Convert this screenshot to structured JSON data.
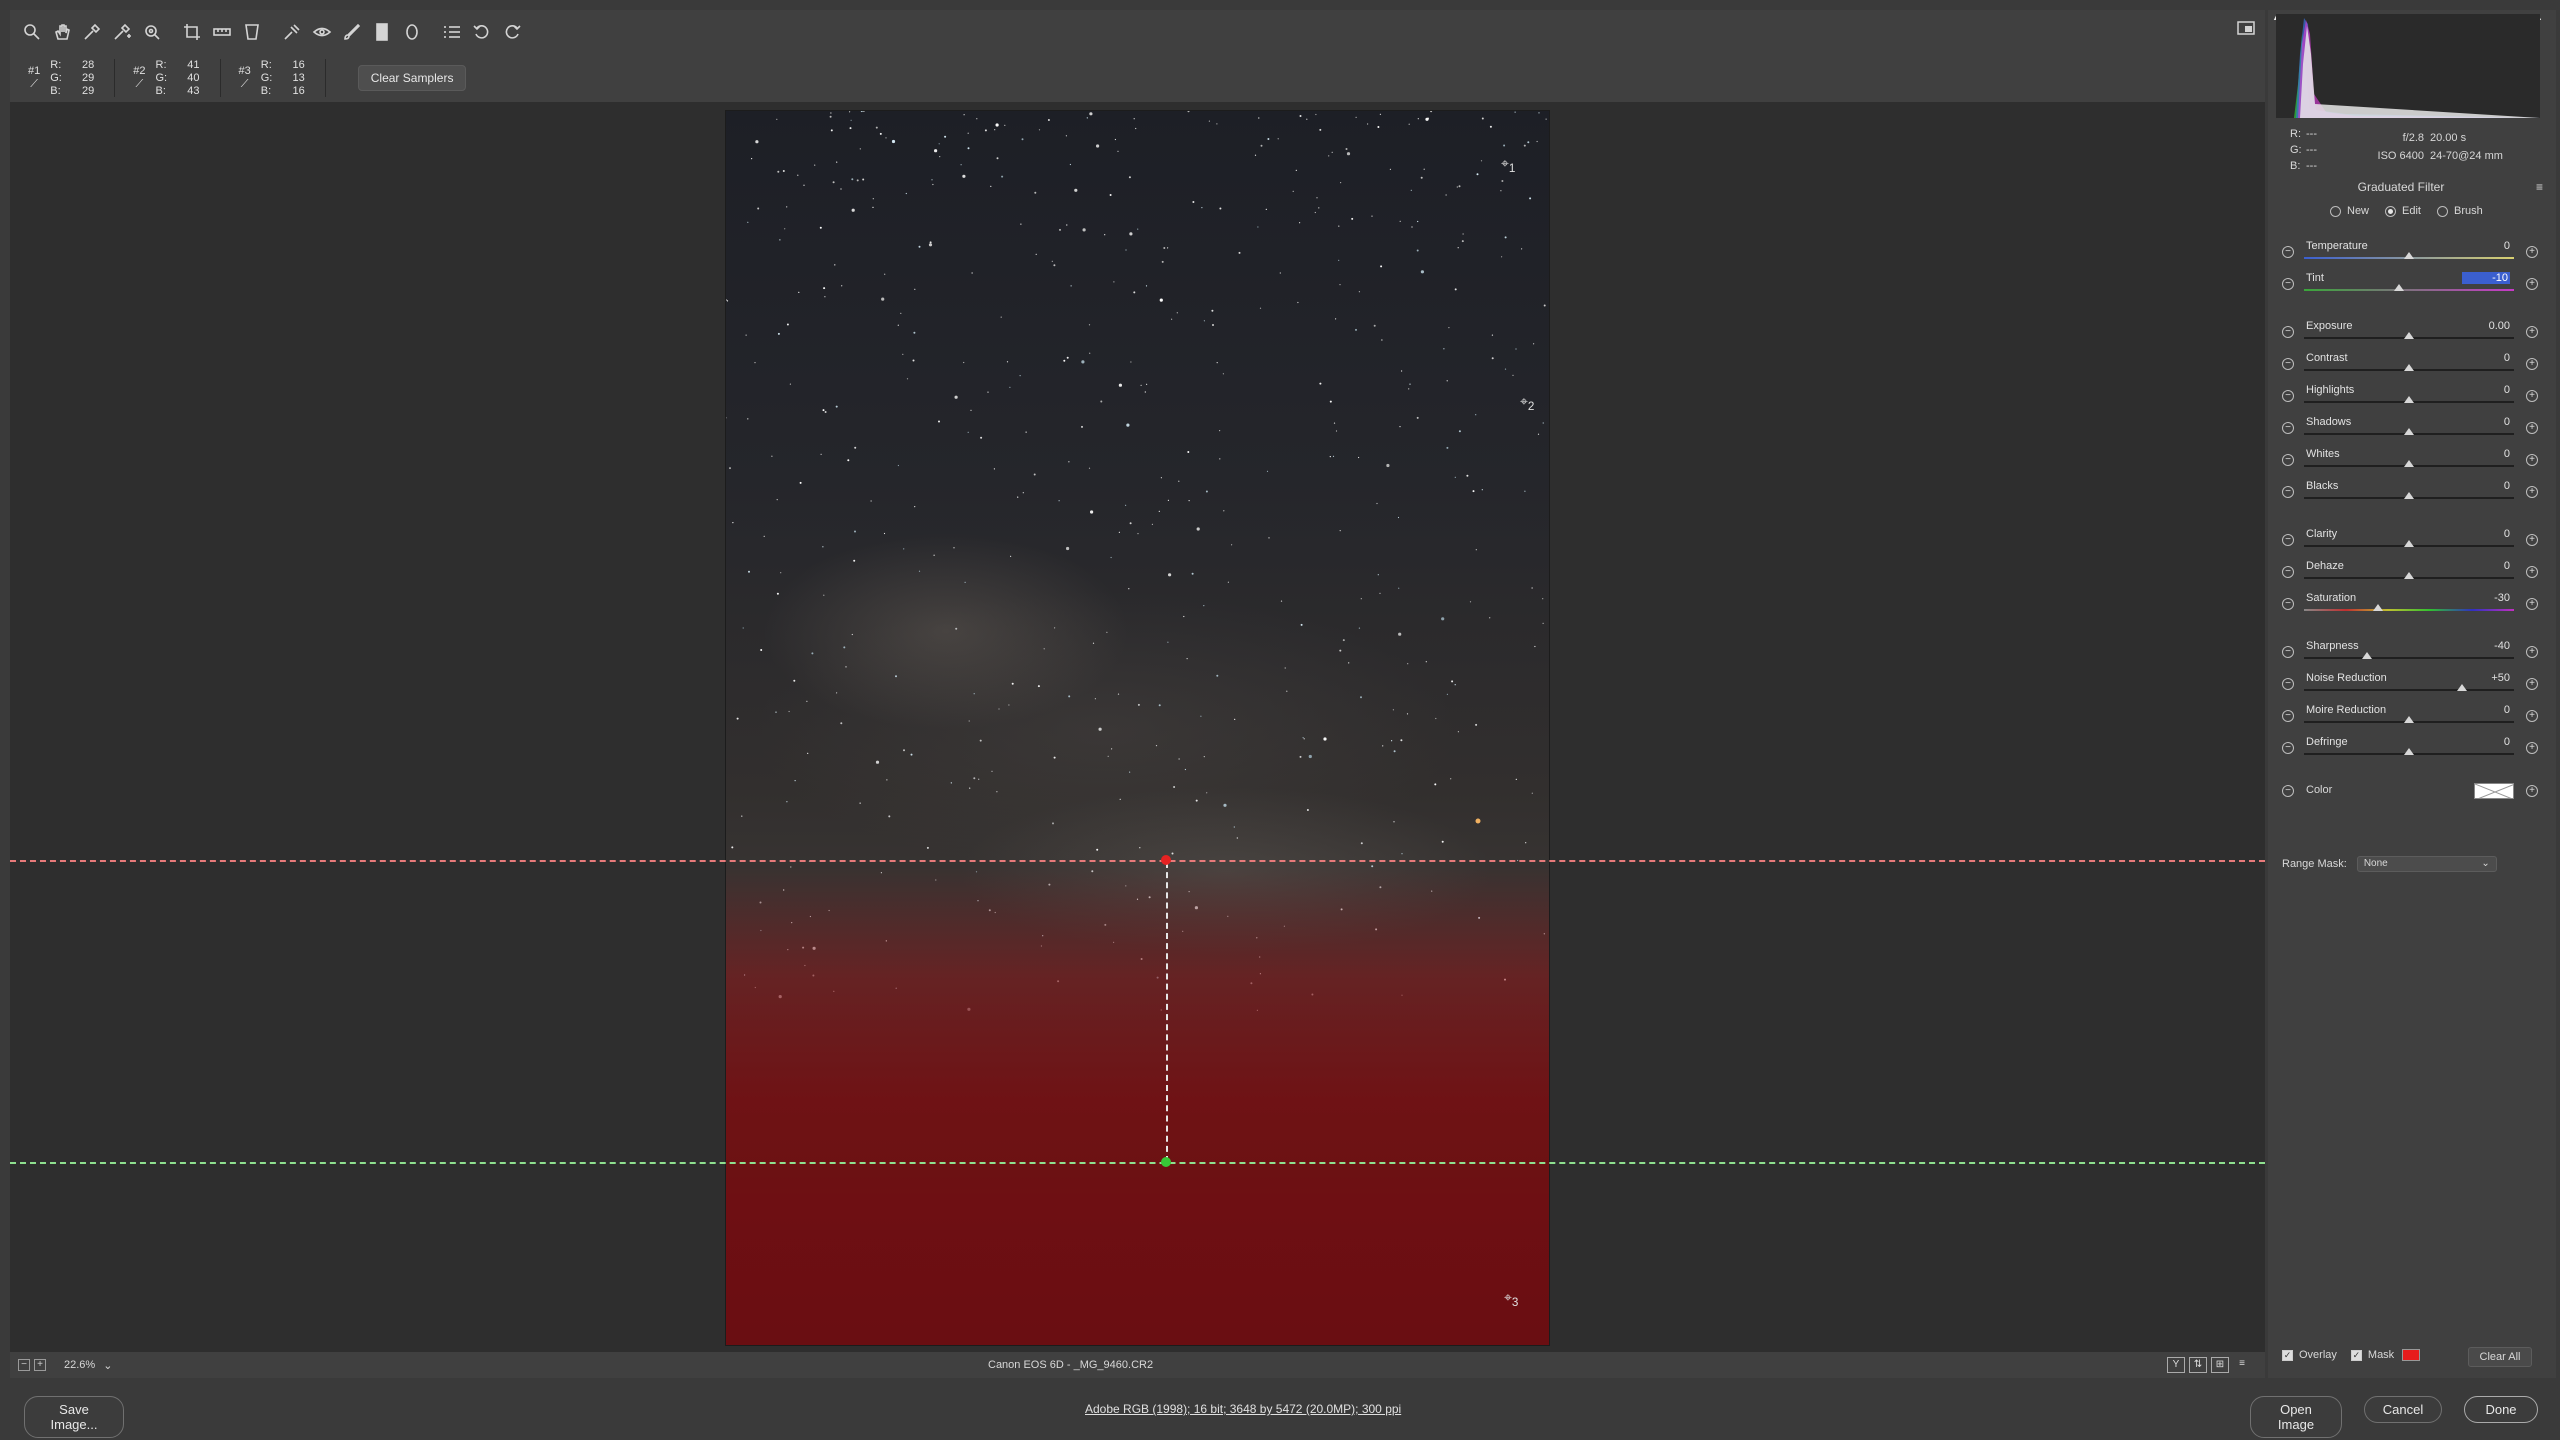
{
  "toolbar": {
    "tools": [
      "zoom-icon",
      "hand-icon",
      "white-balance-icon",
      "color-sampler-icon",
      "targeted-adjustment-icon",
      "crop-icon",
      "straighten-icon",
      "transform-icon",
      "spot-removal-icon",
      "red-eye-icon",
      "adjustment-brush-icon",
      "graduated-filter-icon",
      "radial-filter-icon",
      "preferences-icon",
      "rotate-ccw-icon",
      "rotate-cw-icon"
    ]
  },
  "samplers": {
    "items": [
      {
        "id": "#1",
        "r_label": "R:",
        "g_label": "G:",
        "b_label": "B:",
        "r": "28",
        "g": "29",
        "b": "29"
      },
      {
        "id": "#2",
        "r_label": "R:",
        "g_label": "G:",
        "b_label": "B:",
        "r": "41",
        "g": "40",
        "b": "43"
      },
      {
        "id": "#3",
        "r_label": "R:",
        "g_label": "G:",
        "b_label": "B:",
        "r": "16",
        "g": "13",
        "b": "16"
      }
    ],
    "clear_label": "Clear Samplers"
  },
  "canvas": {
    "pins": [
      "1",
      "2",
      "3"
    ]
  },
  "status": {
    "zoom": "22.6%",
    "file": "Canon EOS 6D  -  _MG_9460.CR2"
  },
  "info": {
    "r_label": "R:",
    "g_label": "G:",
    "b_label": "B:",
    "r": "---",
    "g": "---",
    "b": "---",
    "aperture": "f/2.8",
    "shutter": "20.00 s",
    "iso": "ISO 6400",
    "lens": "24-70@24 mm"
  },
  "panel": {
    "title": "Graduated Filter",
    "modes": [
      {
        "label": "New",
        "selected": false
      },
      {
        "label": "Edit",
        "selected": true
      },
      {
        "label": "Brush",
        "selected": false
      }
    ],
    "sliders": [
      {
        "label": "Temperature",
        "value": "0",
        "level": 0.5
      },
      {
        "label": "Tint",
        "value": "-10",
        "level": 0.45
      },
      {
        "label": "Exposure",
        "value": "0.00",
        "level": 0.5
      },
      {
        "label": "Contrast",
        "value": "0",
        "level": 0.5
      },
      {
        "label": "Highlights",
        "value": "0",
        "level": 0.5
      },
      {
        "label": "Shadows",
        "value": "0",
        "level": 0.5
      },
      {
        "label": "Whites",
        "value": "0",
        "level": 0.5
      },
      {
        "label": "Blacks",
        "value": "0",
        "level": 0.5
      },
      {
        "label": "Clarity",
        "value": "0",
        "level": 0.5
      },
      {
        "label": "Dehaze",
        "value": "0",
        "level": 0.5
      },
      {
        "label": "Saturation",
        "value": "-30",
        "level": 0.35
      },
      {
        "label": "Sharpness",
        "value": "-40",
        "level": 0.3
      },
      {
        "label": "Noise Reduction",
        "value": "+50",
        "level": 0.75
      },
      {
        "label": "Moire Reduction",
        "value": "0",
        "level": 0.5
      },
      {
        "label": "Defringe",
        "value": "0",
        "level": 0.5
      }
    ],
    "color_label": "Color",
    "range_mask_label": "Range Mask:",
    "range_mask_value": "None",
    "overlay_label": "Overlay",
    "mask_label": "Mask",
    "mask_color": "#e71c1c",
    "clear_all_label": "Clear All"
  },
  "footer": {
    "save_label": "Save Image...",
    "workflow": "Adobe RGB (1998); 16 bit; 3648 by 5472 (20.0MP); 300 ppi",
    "open_label": "Open Image",
    "cancel_label": "Cancel",
    "done_label": "Done"
  },
  "colors": {
    "accent_selection": "#3b5fcf",
    "gradient_start_pin": "#e52222",
    "gradient_end_pin": "#37c837",
    "mask_overlay": "#a8080c"
  }
}
